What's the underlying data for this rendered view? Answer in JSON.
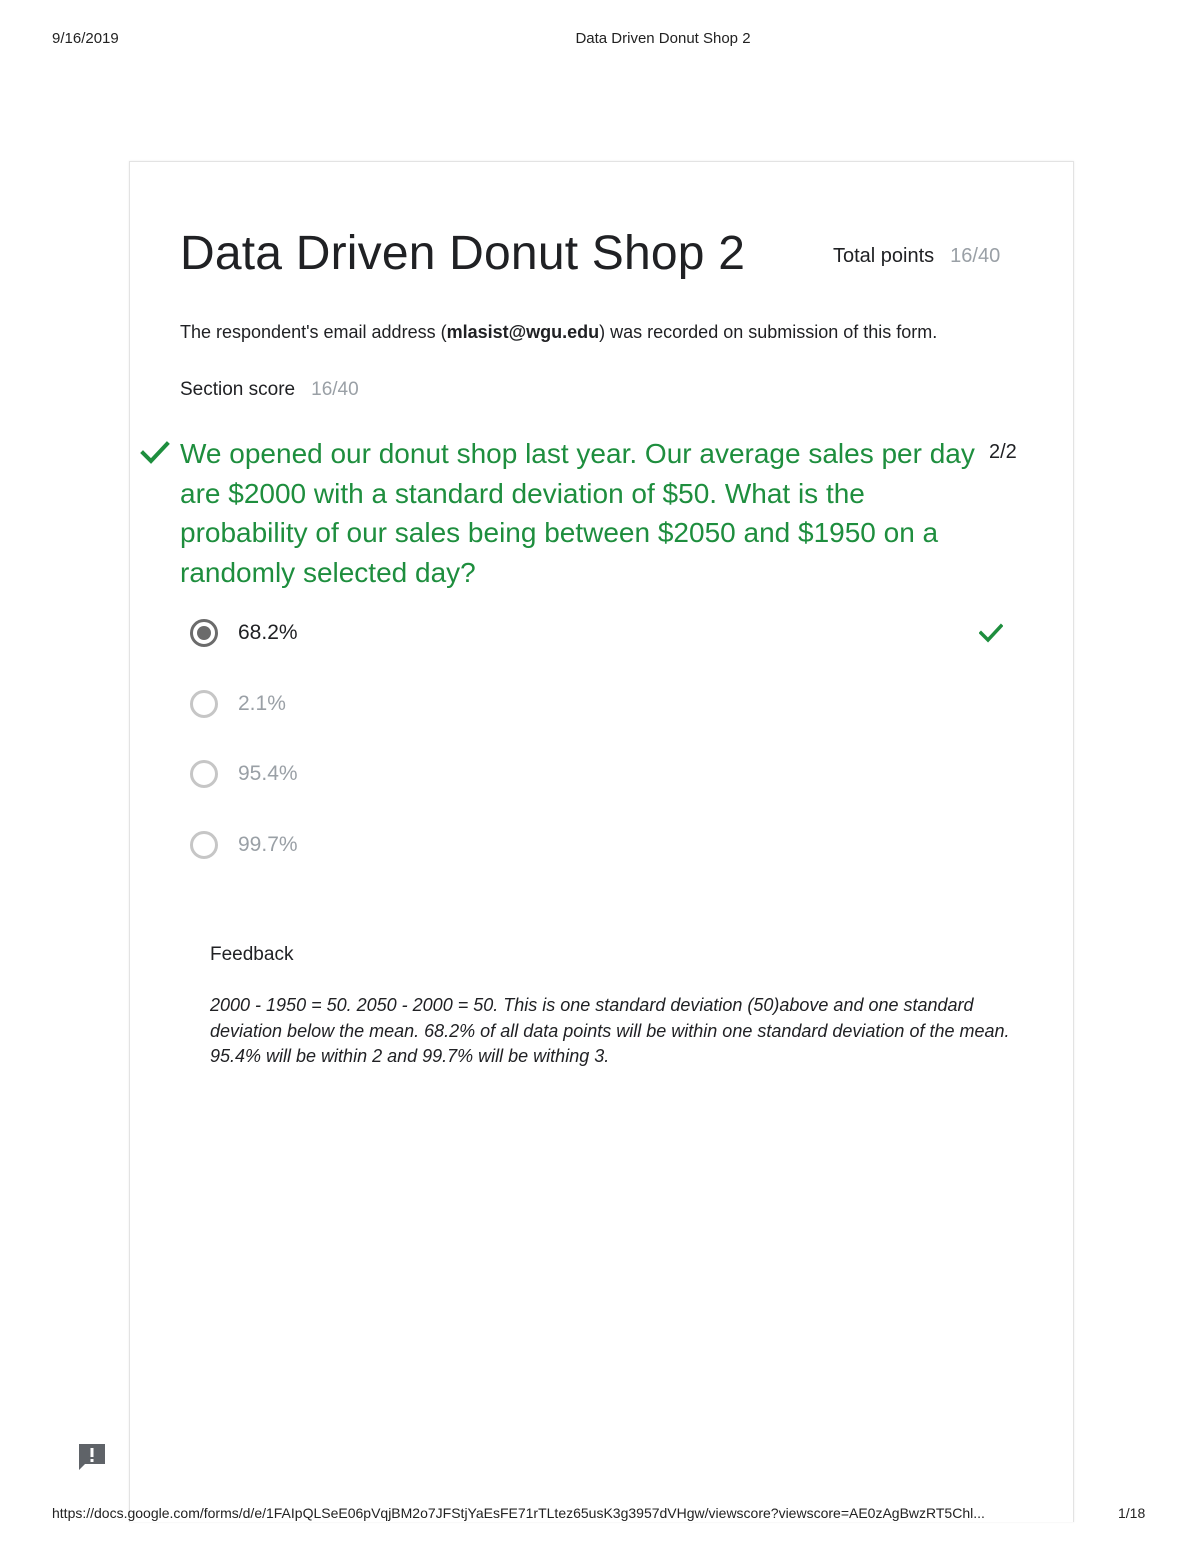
{
  "print_header": {
    "date": "9/16/2019",
    "title": "Data Driven Donut Shop 2"
  },
  "print_footer": {
    "url": "https://docs.google.com/forms/d/e/1FAIpQLSeE06pVqjBM2o7JFStjYaEsFE71rTLtez65usK3g3957dVHgw/viewscore?viewscore=AE0zAgBwzRT5Chl...",
    "page": "1/18"
  },
  "form": {
    "title": "Data Driven Donut Shop 2",
    "total_points_label": "Total points",
    "total_points_value": "16/40",
    "email_prefix": "The respondent's email address (",
    "email": "mlasist@wgu.edu",
    "email_suffix": ") was recorded on submission of this form.",
    "section_score_label": "Section score",
    "section_score_value": "16/40"
  },
  "question": {
    "text": "We opened our donut shop last year. Our average sales per day are $2000 with a standard deviation of $50. What is the probability of our sales being between $2050 and $1950 on a randomly selected day?",
    "score": "2/2",
    "status": "correct",
    "options": [
      {
        "label": "68.2%",
        "selected": true,
        "correct": true
      },
      {
        "label": "2.1%",
        "selected": false,
        "correct": false
      },
      {
        "label": "95.4%",
        "selected": false,
        "correct": false
      },
      {
        "label": "99.7%",
        "selected": false,
        "correct": false
      }
    ],
    "feedback_title": "Feedback",
    "feedback_text": "2000 - 1950 = 50. 2050 - 2000 = 50. This is one standard deviation (50)above and one standard deviation below the mean. 68.2% of all data points will be within one standard deviation of the mean. 95.4% will be within 2 and 99.7% will be withing 3."
  },
  "colors": {
    "correct_green": "#1e8e3e",
    "muted_gray": "#9aa0a6",
    "text": "#202124"
  },
  "icons": {
    "question_status": "check-icon",
    "option_correct": "check-icon",
    "report": "report-issue-icon"
  }
}
